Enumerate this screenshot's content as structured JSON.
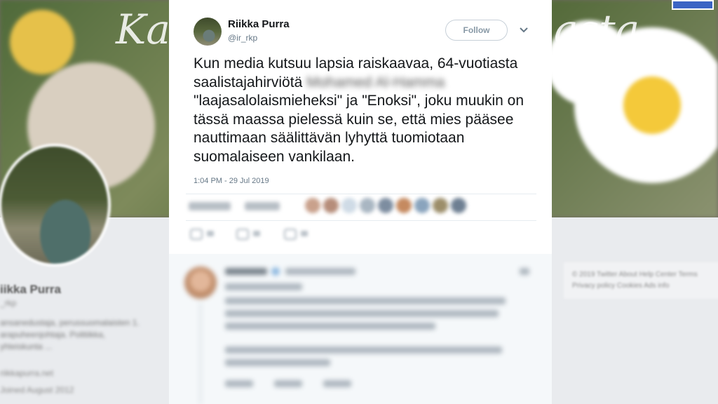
{
  "background": {
    "header_script_left": "Ka",
    "header_script_right": "asta",
    "profile_name": "iikka Purra",
    "profile_handle": "_rkp",
    "profile_bio": "ansanedustaja, perussuomalaisten 1. arapuheenjohtaja. Politiikka, yhteiskunta ...",
    "profile_meta": [
      "riikkapurra.net",
      "Joined August 2012"
    ],
    "footer_line1": "© 2019 Twitter  About  Help Center  Terms",
    "footer_line2": "Privacy policy  Cookies  Ads info"
  },
  "tweet": {
    "author_name": "Riikka Purra",
    "author_handle": "@ir_rkp",
    "follow_label": "Follow",
    "caret_icon": "chevron-down-icon",
    "text_part1": "Kun media kutsuu lapsia raiskaavaa, 64-vuotiasta saalistajahirviötä ",
    "text_redacted": "Mohamed Al-Hamma",
    "text_part2": " \"laajasalolaismieheksi\" ja \"Enoksi\", joku muukin on tässä maassa pielessä kuin se, että mies pääsee nauttimaan säälittävän lyhyttä tuomiotaan suomalaiseen vankilaan.",
    "timestamp": "1:04 PM - 29 Jul 2019"
  },
  "colors": {
    "accent": "#1da1f2",
    "text": "#14171a",
    "secondary": "#657786",
    "follow_border": "#c7d0d8"
  }
}
